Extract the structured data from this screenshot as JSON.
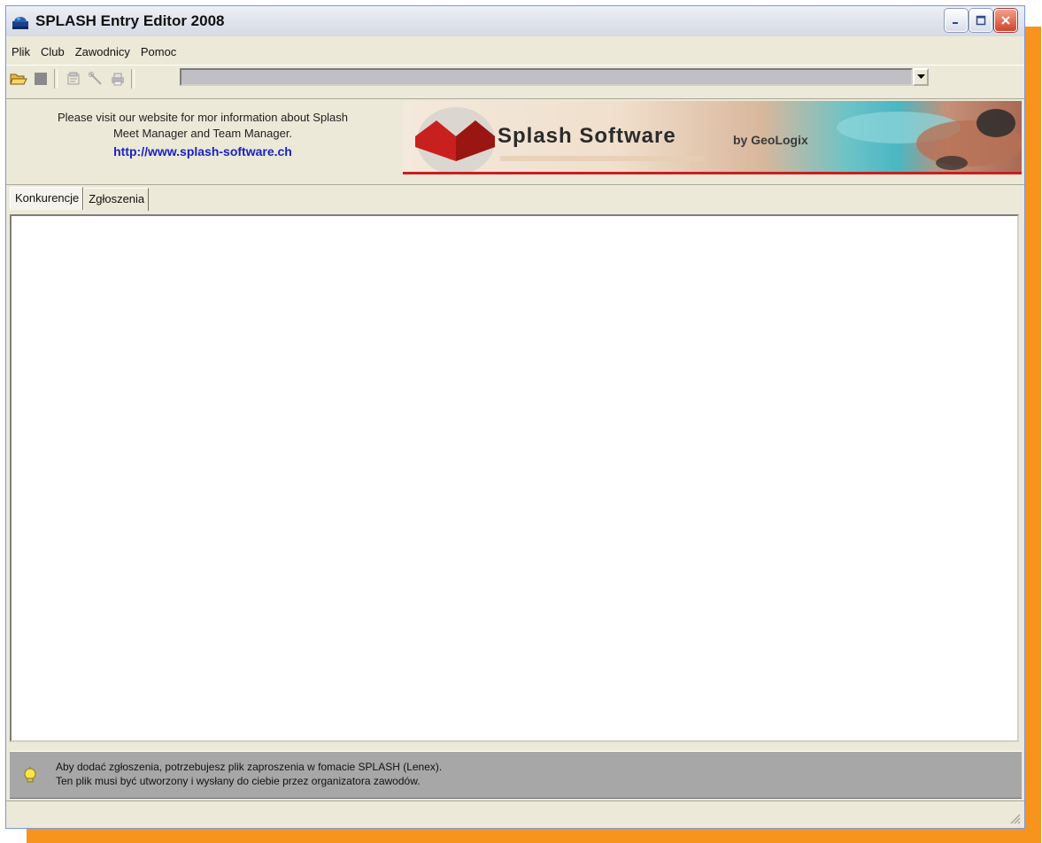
{
  "window": {
    "title": "SPLASH Entry Editor 2008",
    "controls": [
      "minimize",
      "maximize",
      "close"
    ]
  },
  "menu": {
    "items": [
      "Plik",
      "Club",
      "Zawodnicy",
      "Pomoc"
    ]
  },
  "toolbar": {
    "icons": [
      "open-folder-icon",
      "stop-icon",
      "properties-icon",
      "tools-icon",
      "print-icon"
    ],
    "combo_value": ""
  },
  "info": {
    "line1": "Please visit our website for mor information about Splash",
    "line2": "Meet Manager and Team Manager.",
    "url": "http://www.splash-software.ch"
  },
  "banner": {
    "brand": "Splash Software",
    "byline": "by GeoLogix"
  },
  "tabs": [
    {
      "label": "Konkurencje",
      "active": true
    },
    {
      "label": "Zgłoszenia",
      "active": false
    }
  ],
  "hint": {
    "icon": "lightbulb-icon",
    "line1": "Aby dodać zgłoszenia, potrzebujesz plik zaproszenia w fomacie SPLASH (Lenex).",
    "line2": "Ten plik musi być utworzony i wysłany do ciebie przez organizatora zawodów."
  },
  "colors": {
    "accent_shadow": "#f7941d",
    "link": "#1a21c8",
    "brand_red": "#c8201e"
  }
}
